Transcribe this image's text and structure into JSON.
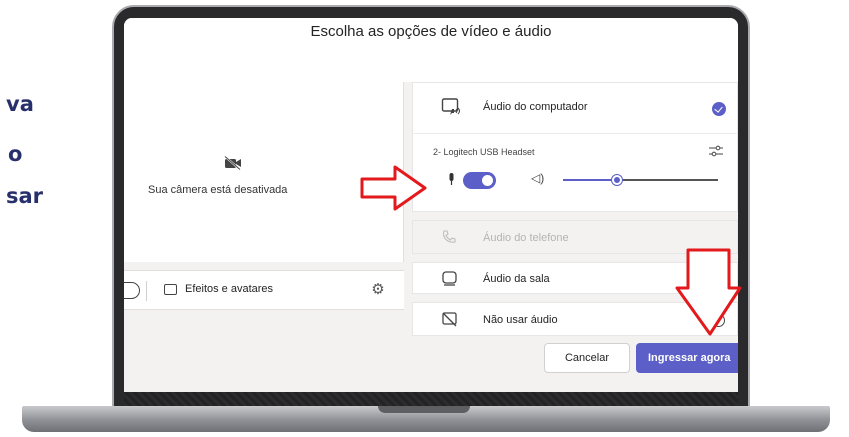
{
  "side_text": {
    "line1": "va",
    "line2": "o",
    "line3": "sar"
  },
  "dialog": {
    "title": "Escolha as opções de vídeo e áudio"
  },
  "camera": {
    "status": "Sua câmera está desativada",
    "camera_on": false
  },
  "effects": {
    "label": "Efeitos e avatares"
  },
  "audio": {
    "computer": {
      "label": "Áudio do computador",
      "selected": true
    },
    "device": {
      "name": "2- Logitech USB Headset",
      "mic_on": true,
      "volume": 0.35
    },
    "phone": {
      "label": "Áudio do telefone",
      "disabled": true
    },
    "room": {
      "label": "Áudio da sala",
      "selected": false
    },
    "none": {
      "label": "Não usar áudio",
      "selected": false
    }
  },
  "buttons": {
    "cancel": "Cancelar",
    "join": "Ingressar agora"
  },
  "colors": {
    "accent": "#5b5fc7",
    "annotation": "#e3191c",
    "heading": "#27306b"
  },
  "icons": [
    "camera-off-icon",
    "effects-icon",
    "gear-icon",
    "computer-audio-icon",
    "check-icon",
    "sliders-icon",
    "microphone-icon",
    "speaker-icon",
    "phone-icon",
    "room-icon",
    "no-audio-icon",
    "red-arrow-icon"
  ]
}
